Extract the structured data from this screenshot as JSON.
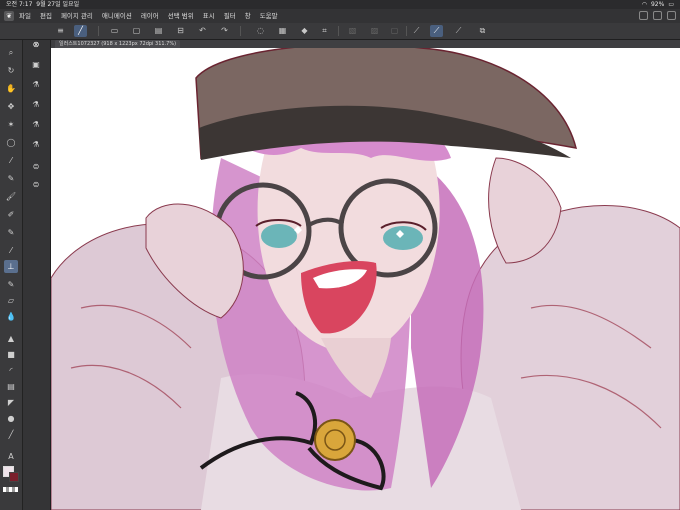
{
  "status_bar": {
    "time": "오전 7:17",
    "date": "9월 27일 일요일",
    "battery": "92%"
  },
  "menu": {
    "items": [
      "파일",
      "편집",
      "페이지 관리",
      "애니메이션",
      "레이어",
      "선택 범위",
      "표시",
      "필터",
      "창",
      "도움말"
    ]
  },
  "document": {
    "tab_title": "일러스트1072327 (918 x 1223px 72dpi 311.7%)"
  },
  "colors": {
    "main_color": "#efe3ea",
    "sub_color": "#7a1f2c",
    "accent": "#4a5f7e"
  },
  "toolbar": {
    "icons": [
      "menu-icon",
      "brush-settings-icon",
      "new-icon",
      "open-icon",
      "save-icon",
      "print-icon",
      "undo-icon",
      "redo-icon",
      "lasso-icon",
      "select-all-icon",
      "deselect-icon",
      "fill-icon",
      "transform-icon",
      "grid-icon",
      "frame-icon",
      "fill-bucket-icon",
      "ruler-icon",
      "pen-active-icon",
      "pencil-icon",
      "eraser-ruler-icon"
    ]
  },
  "tools": {
    "primary": [
      "zoom-icon",
      "rotate-icon",
      "hand-icon",
      "move-icon",
      "magic-wand-icon",
      "lasso-select-icon",
      "eyedropper-icon",
      "pen-icon",
      "brush-icon",
      "airbrush-icon",
      "blend-icon",
      "gradient-icon",
      "fill-tool-icon",
      "figure-icon",
      "frame-border-icon",
      "text-icon",
      "balloon-icon",
      "line-icon",
      "correct-icon",
      "decoration-icon",
      "eraser-icon",
      "smudge-icon"
    ],
    "sub": [
      "sub-tool-pen-icon",
      "sub-tool-marker-icon",
      "sub-tool-brush-icon",
      "sub-tool-pencil-icon",
      "sub-tool-ink-icon",
      "sub-tool-layer-icon",
      "sub-tool-stack-icon"
    ]
  }
}
